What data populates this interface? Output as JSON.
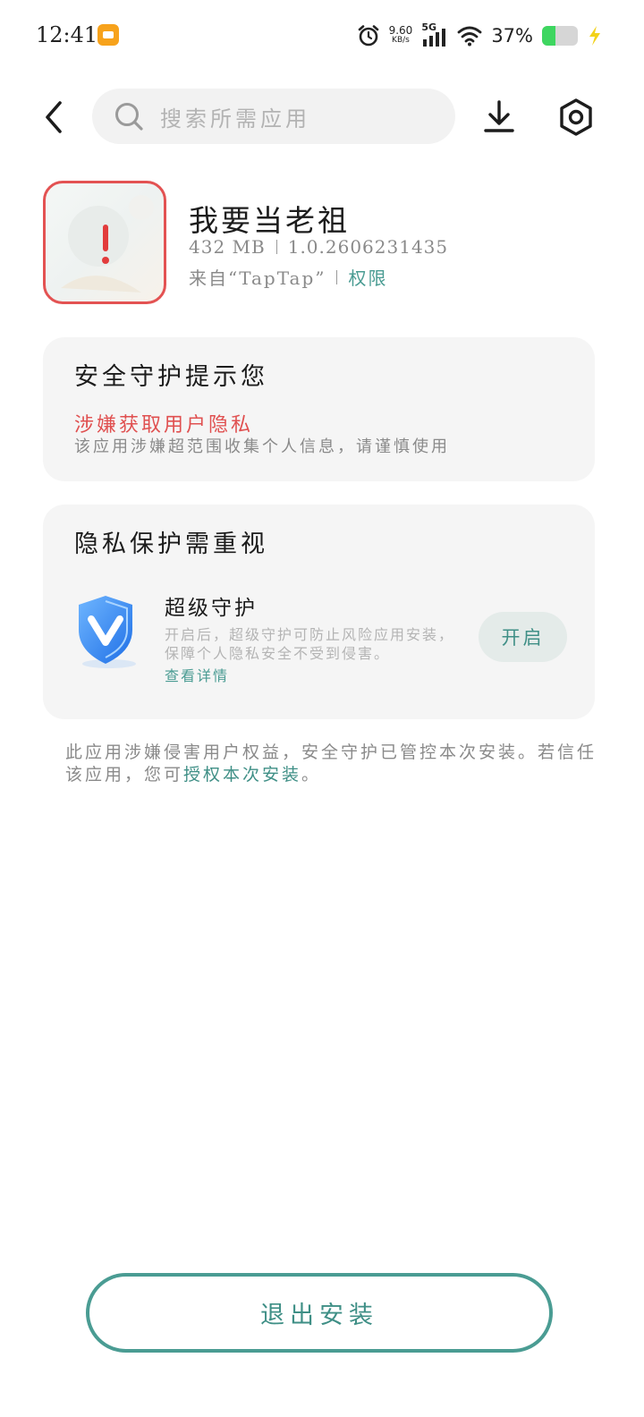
{
  "status_bar": {
    "time": "12:41",
    "net_speed_value": "9.60",
    "net_speed_unit": "KB/s",
    "network_type": "5G",
    "battery_percent_text": "37%",
    "battery_level": 0.37,
    "icons": [
      "app-notification-icon",
      "alarm-icon",
      "signal-icon",
      "wifi-icon",
      "battery-icon",
      "charging-icon"
    ]
  },
  "top_bar": {
    "search_placeholder": "搜索所需应用",
    "icons": [
      "back-arrow-icon",
      "search-icon",
      "download-icon",
      "settings-icon"
    ]
  },
  "app": {
    "name": "我要当老祖",
    "size": "432 MB",
    "version": "1.0.2606231435",
    "source": "来自“TapTap”",
    "permissions_label": "权限"
  },
  "security_card": {
    "title": "安全守护提示您",
    "warning_title": "涉嫌获取用户隐私",
    "warning_desc": "该应用涉嫌超范围收集个人信息，请谨慎使用"
  },
  "privacy_card": {
    "title": "隐私保护需重视",
    "feature_title": "超级守护",
    "feature_desc": "开启后，超级守护可防止风险应用安装，保障个人隐私安全不受到侵害。",
    "feature_link": "查看详情",
    "enable_button": "开启"
  },
  "footnote": {
    "text_before": "此应用涉嫌侵害用户权益，安全守护已管控本次安装。若信任该应用，您可",
    "link": "授权本次安装",
    "text_after": "。"
  },
  "exit_button": "退出安装",
  "colors": {
    "accent": "#4a9c93",
    "warning": "#e05050",
    "card_bg": "#f5f5f5",
    "battery_green": "#3ed660"
  }
}
